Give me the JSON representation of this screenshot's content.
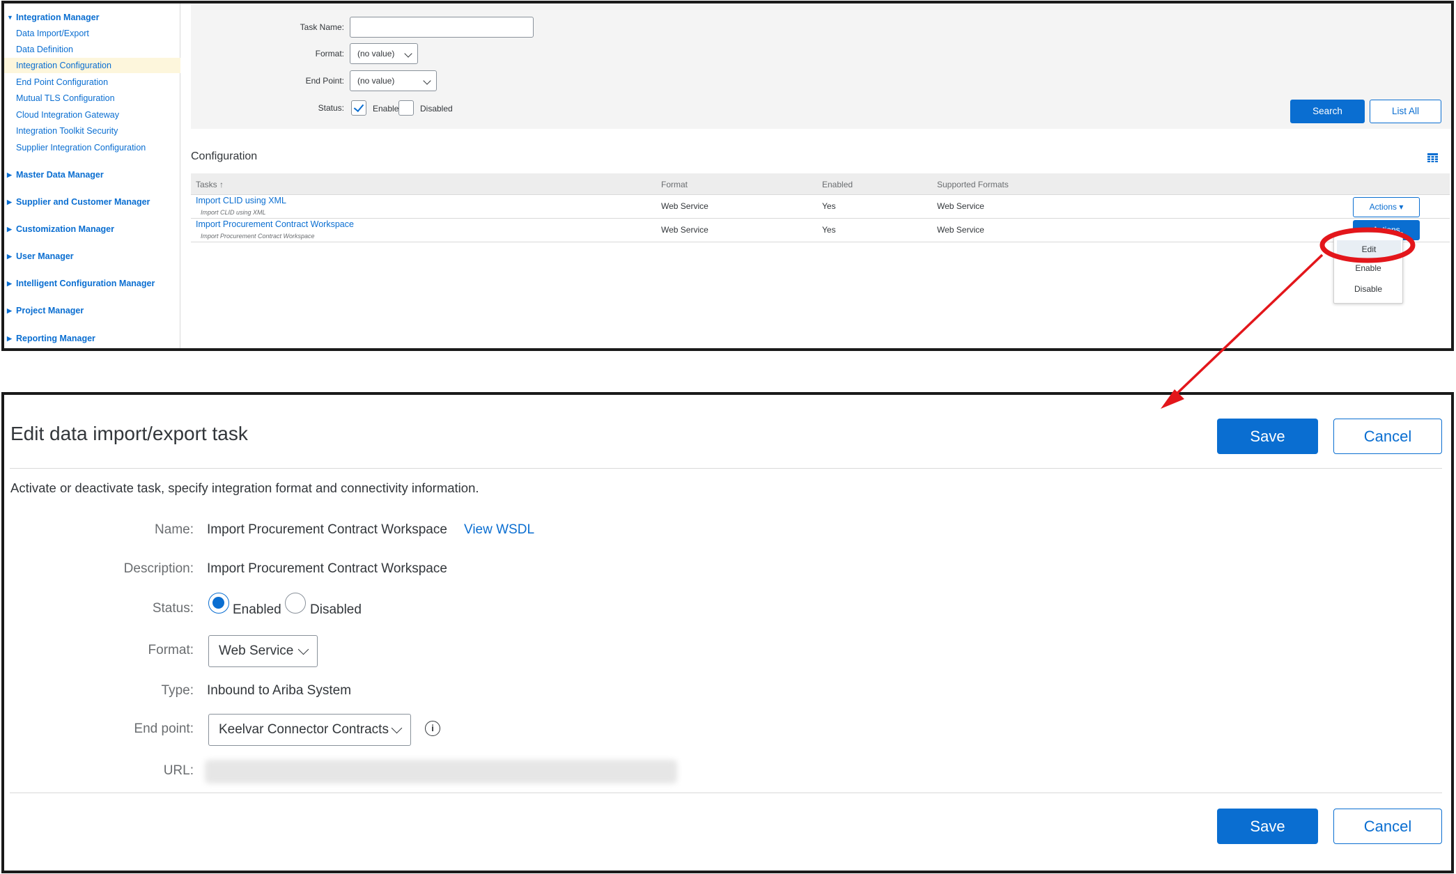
{
  "sidebar": {
    "integration_manager": {
      "label": "Integration Manager",
      "items": [
        "Data Import/Export",
        "Data Definition",
        "Integration Configuration",
        "End Point Configuration",
        "Mutual TLS Configuration",
        "Cloud Integration Gateway",
        "Integration Toolkit Security",
        "Supplier Integration Configuration"
      ],
      "selected": "Integration Configuration"
    },
    "sections": [
      "Master Data Manager",
      "Supplier and Customer Manager",
      "Customization Manager",
      "User Manager",
      "Intelligent Configuration Manager",
      "Project Manager",
      "Reporting Manager"
    ]
  },
  "search": {
    "task_name_label": "Task Name:",
    "task_name_value": "",
    "format_label": "Format:",
    "format_value": "(no value)",
    "endpoint_label": "End Point:",
    "endpoint_value": "(no value)",
    "status_label": "Status:",
    "enabled_label": "Enabled",
    "enabled_checked": true,
    "disabled_label": "Disabled",
    "disabled_checked": false,
    "search_button": "Search",
    "list_all_button": "List All"
  },
  "configuration": {
    "title": "Configuration",
    "columns": {
      "tasks": "Tasks",
      "format": "Format",
      "enabled": "Enabled",
      "supported_formats": "Supported Formats"
    },
    "rows": [
      {
        "task": "Import CLID using XML",
        "subtitle": "Import CLID using XML",
        "format": "Web Service",
        "enabled": "Yes",
        "supported_formats": "Web Service",
        "actions": "Actions ▾"
      },
      {
        "task": "Import Procurement Contract Workspace",
        "subtitle": "Import Procurement Contract Workspace",
        "format": "Web Service",
        "enabled": "Yes",
        "supported_formats": "Web Service",
        "actions": "Actions"
      }
    ],
    "actions_menu": [
      "Edit",
      "Enable",
      "Disable"
    ],
    "highlighted_menu_item": "Edit"
  },
  "edit_dialog": {
    "title": "Edit data import/export task",
    "save_label": "Save",
    "cancel_label": "Cancel",
    "description": "Activate or deactivate task, specify integration format and connectivity information.",
    "name_label": "Name:",
    "name_value": "Import Procurement Contract Workspace",
    "view_wsdl": "View WSDL",
    "description_label": "Description:",
    "description_value": "Import Procurement Contract Workspace",
    "status_label": "Status:",
    "status_enabled": "Enabled",
    "status_disabled": "Disabled",
    "status_selected": "Enabled",
    "format_label": "Format:",
    "format_value": "Web Service",
    "type_label": "Type:",
    "type_value": "Inbound to Ariba System",
    "endpoint_label": "End point:",
    "endpoint_value": "Keelvar Connector Contracts",
    "url_label": "URL:"
  },
  "colors": {
    "accent": "#0a6ed1",
    "annotation": "#e3161b",
    "selected_row_bg": "#fdf6dc"
  },
  "icons": {
    "expand": "triangle-right",
    "collapse": "triangle-down",
    "sort": "arrow-up",
    "table_settings": "grid-icon",
    "info": "info-icon",
    "dropdown": "chevron-down-icon"
  }
}
